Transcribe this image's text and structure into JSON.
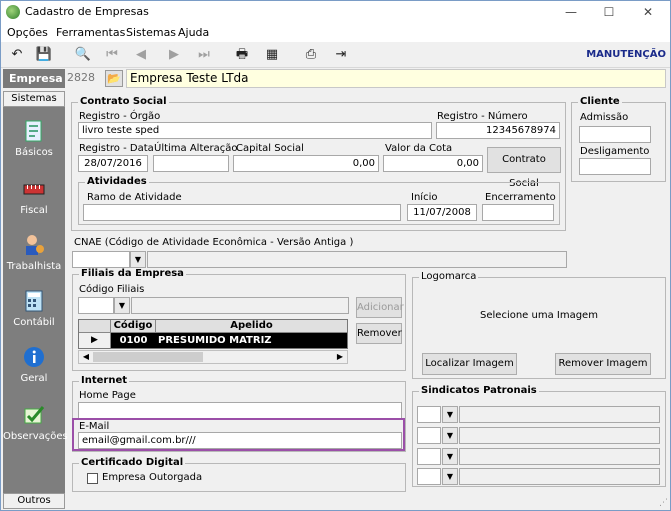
{
  "window": {
    "title": "Cadastro de Empresas",
    "min": "—",
    "max": "☐",
    "close": "✕"
  },
  "menu": [
    "Opções",
    "Ferramentas",
    "Sistemas",
    "Ajuda"
  ],
  "toolbar": {
    "mode": "MANUTENÇÃO"
  },
  "empresa": {
    "label": "Empresa",
    "code": "2828",
    "name": "Empresa Teste LTda"
  },
  "sidebar": {
    "header": "Sistemas",
    "footer": "Outros",
    "items": [
      "Básicos",
      "Fiscal",
      "Trabalhista",
      "Contábil",
      "Geral",
      "Observações"
    ]
  },
  "contrato": {
    "title": "Contrato Social",
    "registro_orgao_label": "Registro - Órgão",
    "registro_orgao": "livro teste sped",
    "registro_numero_label": "Registro - Número",
    "registro_numero": "12345678974",
    "registro_data_label": "Registro - Data",
    "registro_data": "28/07/2016",
    "ultima_alteracao_label": "Última Alteração",
    "ultima_alteracao": "",
    "capital_social_label": "Capital Social",
    "capital_social": "0,00",
    "valor_cota_label": "Valor da Cota",
    "valor_cota": "0,00",
    "button": "Contrato Social"
  },
  "atividades": {
    "title": "Atividades",
    "ramo_label": "Ramo de Atividade",
    "ramo": "",
    "inicio_label": "Início",
    "inicio": "11/07/2008",
    "encerramento_label": "Encerramento",
    "encerramento": ""
  },
  "cliente": {
    "title": "Cliente",
    "admissao_label": "Admissão",
    "desligamento_label": "Desligamento"
  },
  "cnae": {
    "label": "CNAE (Código de Atividade Econômica - Versão Antiga )"
  },
  "filiais": {
    "title": "Filiais da Empresa",
    "codigo_label": "Código Filiais",
    "adicionar": "Adicionar",
    "remover": "Remover",
    "columns": [
      "Código",
      "Apelido"
    ],
    "rows": [
      {
        "codigo": "0100",
        "apelido": "PRESUMIDO MATRIZ"
      }
    ]
  },
  "logomarca": {
    "title": "Logomarca",
    "placeholder": "Selecione  uma  Imagem",
    "localizar": "Localizar Imagem",
    "remover": "Remover Imagem"
  },
  "internet": {
    "title": "Internet",
    "homepage_label": "Home Page",
    "homepage": "",
    "email_label": "E-Mail",
    "email": "email@gmail.com.br///"
  },
  "sindicatos": {
    "title": "Sindicatos Patronais"
  },
  "certificado": {
    "title": "Certificado Digital",
    "checkbox": "Empresa Outorgada"
  }
}
